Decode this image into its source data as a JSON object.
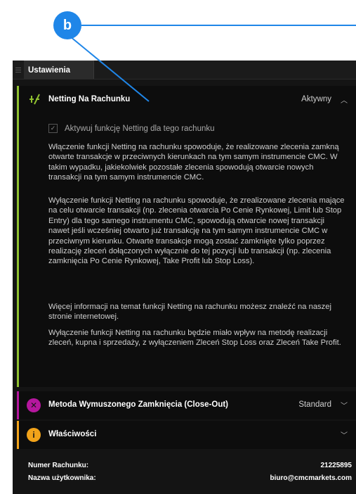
{
  "callout": {
    "label": "b",
    "color": "#1f86e8"
  },
  "tabs": [
    {
      "label": "Ustawienia",
      "active": true
    }
  ],
  "netting": {
    "title": "Netting Na Rachunku",
    "status": "Aktywny",
    "accent": "#8fbf2f",
    "icon": "netting-icon",
    "checkbox_label": "Aktywuj funkcję Netting dla tego rachunku",
    "checkbox_checked": true,
    "paragraphs": [
      "Włączenie funkcji Netting na rachunku spowoduje, że realizowane zlecenia zamkną otwarte transakcje w przeciwnych kierunkach na tym samym instrumencie CMC. W takim wypadku, jakiekolwiek pozostałe zlecenia spowodują otwarcie nowych transakcji na tym samym instrumencie CMC.",
      "Wyłączenie funkcji Netting na rachunku spowoduje, że zrealizowane zlecenia mające na celu otwarcie transakcji (np. zlecenia otwarcia Po Cenie Rynkowej, Limit lub Stop Entry) dla tego samego instrumentu CMC, spowodują otwarcie nowej transakcji nawet jeśli wcześniej otwarto już transakcję na tym samym instrumencie CMC w przeciwnym kierunku. Otwarte transakcje mogą zostać zamknięte tylko poprzez realizację zleceń dołączonych wyłącznie do tej pozycji lub transakcji (np. zlecenia zamknięcia Po Cenie Rynkowej, Take Profit lub Stop Loss).",
      "Więcej informacji na temat funkcji Netting na rachunku możesz znaleźć na naszej stronie internetowej.",
      "Wyłączenie funkcji Netting na rachunku będzie miało wpływ na metodę realizacji zleceń, kupna i sprzedaży, z wyłączeniem Zleceń Stop Loss oraz Zleceń Take Profit."
    ]
  },
  "closeout": {
    "title": "Metoda Wymuszonego Zamknięcia (Close-Out)",
    "status": "Standard",
    "accent": "#b5179e",
    "icon": "close-circle-icon",
    "icon_glyph": "✕"
  },
  "properties": {
    "title": "Właściwości",
    "accent": "#f2a31a",
    "icon": "info-icon",
    "icon_glyph": "i"
  },
  "footer": {
    "account_label": "Numer Rachunku:",
    "account_value": "21225895",
    "user_label": "Nazwa użytkownika:",
    "user_value": "biuro@cmcmarkets.com"
  }
}
